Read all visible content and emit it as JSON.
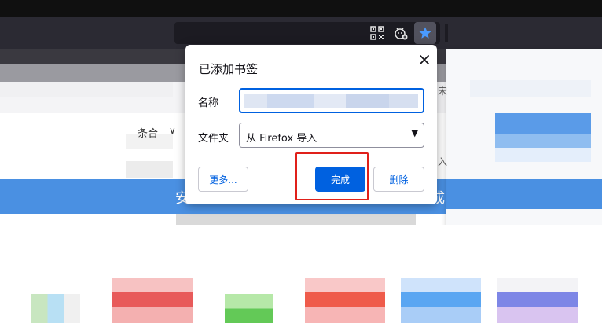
{
  "toolbar": {
    "icons": [
      "qr-code-icon",
      "extension-icon",
      "star-icon"
    ],
    "star_color": "#4a9bff"
  },
  "background": {
    "select_text": "条合",
    "select_caret": "∨",
    "right_fragment_top": "宋",
    "right_fragment_bottom": "入",
    "strip_left": "安",
    "strip_right": "成"
  },
  "dialog": {
    "title": "已添加书签",
    "close_icon": "close-icon",
    "name_label": "名称",
    "name_value": "",
    "folder_label": "文件夹",
    "folder_value": "从 Firefox 导入",
    "folder_caret": "▼",
    "more_button": "更多...",
    "done_button": "完成",
    "delete_button": "删除"
  },
  "colors": {
    "accent": "#0061e0",
    "highlight": "#e0201a",
    "toolbar": "#2b2a33"
  }
}
